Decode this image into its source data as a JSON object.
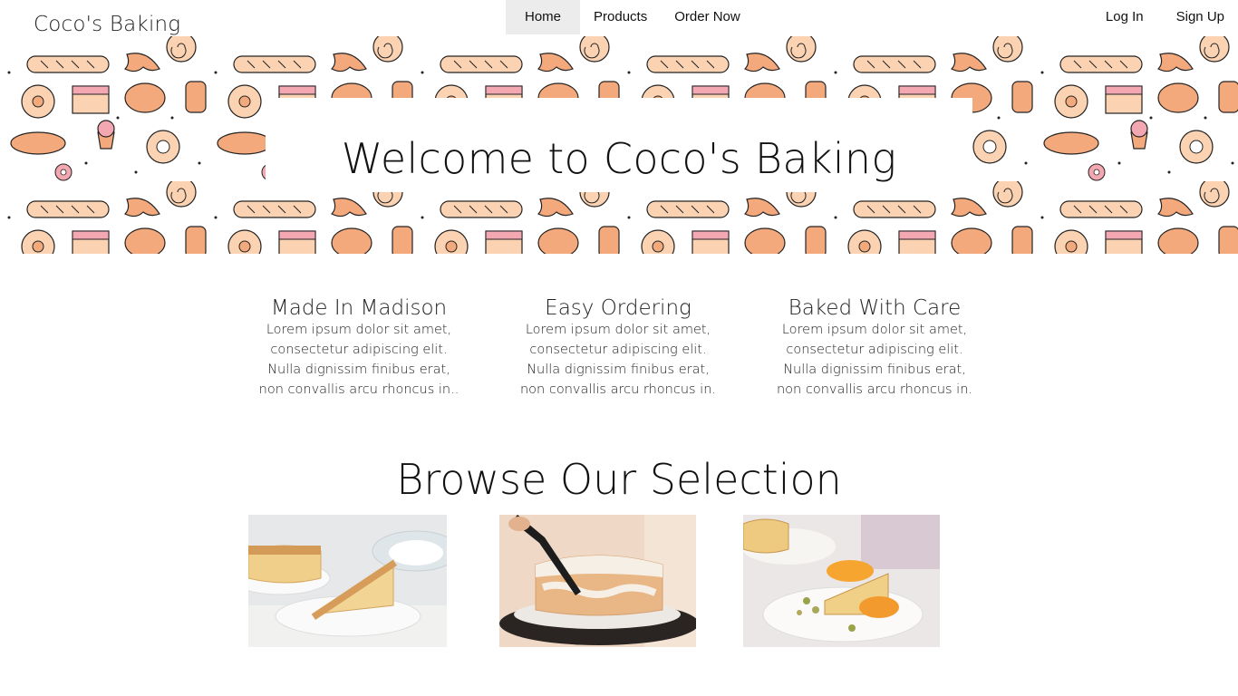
{
  "nav": {
    "brand": "Coco's Baking",
    "links": [
      {
        "label": "Home",
        "active": true
      },
      {
        "label": "Products",
        "active": false
      },
      {
        "label": "Order Now",
        "active": false
      }
    ],
    "auth": {
      "login": "Log In",
      "signup": "Sign Up"
    }
  },
  "hero": {
    "title": "Welcome to Coco's Baking"
  },
  "features": [
    {
      "title": "Made In Madison",
      "text": "Lorem ipsum dolor sit amet, consectetur adipiscing elit. Nulla dignissim finibus erat, non convallis arcu rhoncus in.."
    },
    {
      "title": "Easy Ordering",
      "text": "Lorem ipsum dolor sit amet, consectetur adipiscing elit. Nulla dignissim finibus erat, non convallis arcu rhoncus in."
    },
    {
      "title": "Baked With Care",
      "text": "Lorem ipsum dolor sit amet, consectetur adipiscing elit. Nulla dignissim finibus erat, non convallis arcu rhoncus in."
    }
  ],
  "browse": {
    "title": "Browse Our Selection",
    "products": [
      {
        "name": "sponge-cake-slice-photo"
      },
      {
        "name": "frosting-cake-photo"
      },
      {
        "name": "orange-cake-slice-photo"
      }
    ]
  },
  "colors": {
    "pattern_orange": "#f4a97c",
    "pattern_peach": "#fbd3b2",
    "pattern_pink": "#f2a7b1",
    "active_tab": "#ececec"
  }
}
